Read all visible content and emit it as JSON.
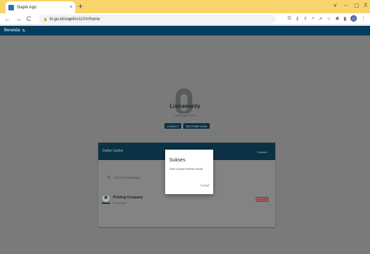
{
  "browser": {
    "tab_title": "Siapik App",
    "tab_close": "×",
    "new_tab": "+",
    "url": "bi.go.id/siapik/v110/#/home",
    "back": "←",
    "forward": "→",
    "reload": "C",
    "minimize": "–",
    "maximize": "▢",
    "close": "X",
    "chevron": "∨"
  },
  "appbar": {
    "title": "Beranda",
    "refresh_icon": "↻"
  },
  "profile": {
    "name": "Lisnawanty",
    "subtitle": "Lisnawanty Sihite",
    "logout_label": "LOGOUT",
    "restore_label": "RESTORE DATA"
  },
  "card": {
    "title": "Daftar Usaha",
    "add_label": "+ Tambah",
    "search_placeholder": "Cari Perusahaan",
    "business": {
      "name": "Printing Company",
      "type": "Percetakan",
      "delete_label": "HAPUS"
    }
  },
  "dialog": {
    "title": "Sukses",
    "message": "Data Usaha berhasil dibuat",
    "button": "TUTUP"
  }
}
